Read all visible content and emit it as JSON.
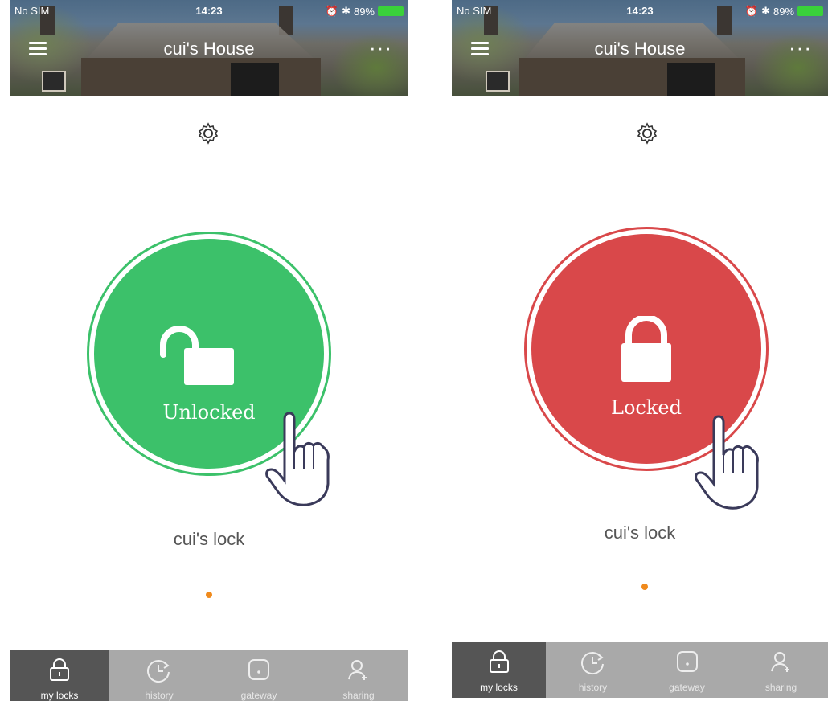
{
  "colors": {
    "unlocked": "#3cc16a",
    "locked": "#d9484a",
    "tabbar": "#a9a9a9",
    "tab_active": "#555555",
    "page_dot": "#f08a1c"
  },
  "screens": [
    {
      "status": {
        "carrier": "No SIM",
        "time": "14:23",
        "battery": "89%"
      },
      "header_title": "cui's House",
      "lock_state_label": "Unlocked",
      "lock_name": "cui's lock",
      "tabs": [
        {
          "label": "my locks",
          "icon": "lock-icon",
          "active": true
        },
        {
          "label": "history",
          "icon": "history-icon",
          "active": false
        },
        {
          "label": "gateway",
          "icon": "gateway-icon",
          "active": false
        },
        {
          "label": "sharing",
          "icon": "user-add-icon",
          "active": false
        }
      ]
    },
    {
      "status": {
        "carrier": "No SIM",
        "time": "14:23",
        "battery": "89%"
      },
      "header_title": "cui's House",
      "lock_state_label": "Locked",
      "lock_name": "cui's lock",
      "tabs": [
        {
          "label": "my locks",
          "icon": "lock-icon",
          "active": true
        },
        {
          "label": "history",
          "icon": "history-icon",
          "active": false
        },
        {
          "label": "gateway",
          "icon": "gateway-icon",
          "active": false
        },
        {
          "label": "sharing",
          "icon": "user-add-icon",
          "active": false
        }
      ]
    }
  ]
}
